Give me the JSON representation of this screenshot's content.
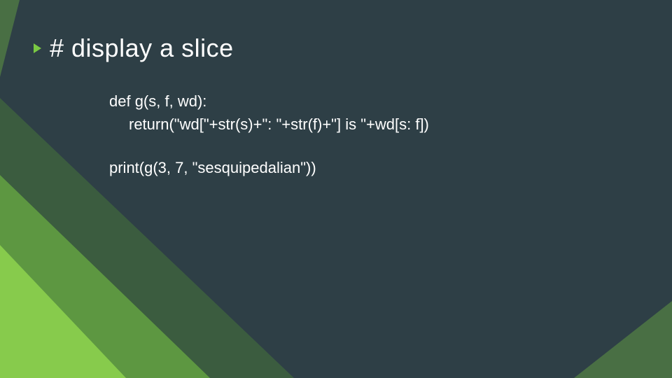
{
  "slide": {
    "title": "# display a slice",
    "code": {
      "line1": "def g(s, f, wd):",
      "line2": "return(\"wd[\"+str(s)+\": \"+str(f)+\"] is \"+wd[s: f])",
      "line3": "print(g(3, 7, \"sesquipedalian\"))"
    },
    "accent_color": "#7ac943",
    "background_color": "#2e3f46"
  }
}
